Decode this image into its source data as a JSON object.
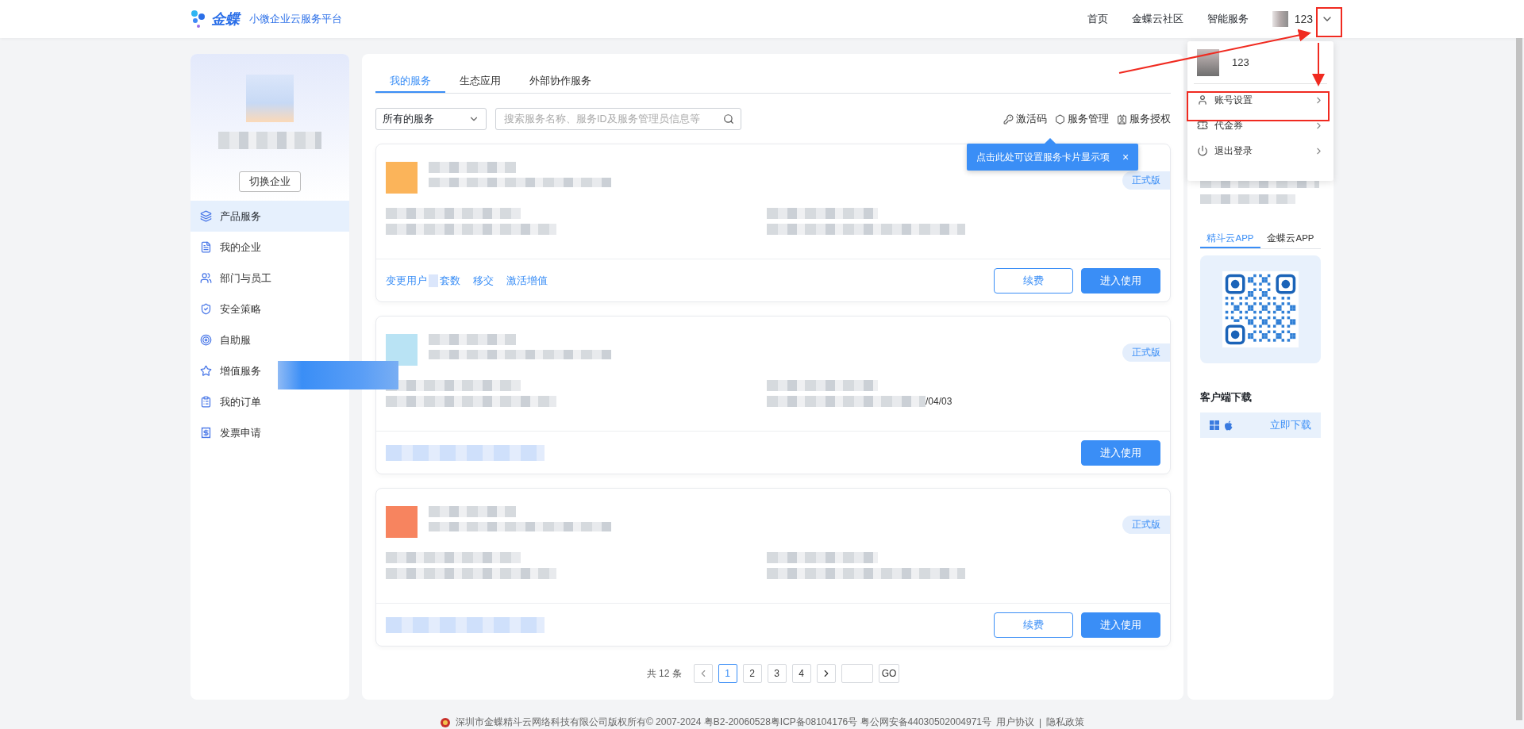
{
  "header": {
    "logo": "金蝶",
    "platform": "小微企业云服务平台",
    "nav": [
      "首页",
      "金蝶云社区",
      "智能服务"
    ],
    "user": "123"
  },
  "user_menu": {
    "name": "123",
    "items": [
      {
        "label": "账号设置",
        "kind": "user"
      },
      {
        "label": "代金券",
        "kind": "voucher"
      },
      {
        "label": "退出登录",
        "kind": "power"
      }
    ]
  },
  "sidebar": {
    "switch_button": "切换企业",
    "items": [
      {
        "label": "产品服务",
        "kind": "layers",
        "selected": true
      },
      {
        "label": "我的企业",
        "kind": "doc",
        "selected": false
      },
      {
        "label": "部门与员工",
        "kind": "users",
        "selected": false
      },
      {
        "label": "安全策略",
        "kind": "shield",
        "selected": false
      },
      {
        "label": "自助服",
        "kind": "target",
        "selected": false
      },
      {
        "label": "增值服务",
        "kind": "star",
        "selected": false
      },
      {
        "label": "我的订单",
        "kind": "list",
        "selected": false
      },
      {
        "label": "发票申请",
        "kind": "receipt",
        "selected": false
      }
    ]
  },
  "main": {
    "tabs": [
      {
        "label": "我的服务",
        "selected": true
      },
      {
        "label": "生态应用",
        "selected": false
      },
      {
        "label": "外部协作服务",
        "selected": false
      }
    ],
    "filter": {
      "value": "所有的服务"
    },
    "search": {
      "placeholder": "搜索服务名称、服务ID及服务管理员信息等"
    },
    "actions": [
      {
        "label": "激活码",
        "kind": "key"
      },
      {
        "label": "服务管理",
        "kind": "hexagon"
      },
      {
        "label": "服务授权",
        "kind": "card"
      }
    ],
    "tooltip": {
      "text": "点击此处可设置服务卡片显示项",
      "close": "×"
    },
    "cards": [
      {
        "color": "#fbb45a",
        "badge": "正式版",
        "links": [
          "变更用户",
          "套数",
          "移交",
          "激活增值"
        ],
        "buttons": [
          {
            "label": "续费",
            "kind": "outline"
          },
          {
            "label": "进入使用",
            "kind": "primary"
          }
        ]
      },
      {
        "color": "#b9e3f4",
        "badge": "正式版",
        "date_fragment": "/04/03",
        "buttons": [
          {
            "label": "进入使用",
            "kind": "primary"
          }
        ]
      },
      {
        "color": "#f7845f",
        "badge": "正式版",
        "buttons": [
          {
            "label": "续费",
            "kind": "outline"
          },
          {
            "label": "进入使用",
            "kind": "primary"
          }
        ]
      }
    ],
    "pagination": {
      "total": "共 12 条",
      "pages": [
        {
          "label": "1",
          "selected": true
        },
        {
          "label": "2",
          "selected": false
        },
        {
          "label": "3",
          "selected": false
        },
        {
          "label": "4",
          "selected": false
        }
      ],
      "go": "GO"
    }
  },
  "right": {
    "app_tabs": [
      {
        "label": "精斗云APP",
        "selected": true
      },
      {
        "label": "金蝶云APP",
        "selected": false
      }
    ],
    "download_title": "客户端下载",
    "download_link": "立即下载"
  },
  "footer": {
    "copyright": "深圳市金蝶精斗云网络科技有限公司版权所有© 2007-2024  粤B2-20060528粤ICP备08104176号  粤公网安备44030502004971号",
    "links": [
      "用户协议",
      "隐私政策"
    ],
    "separator": "|"
  }
}
